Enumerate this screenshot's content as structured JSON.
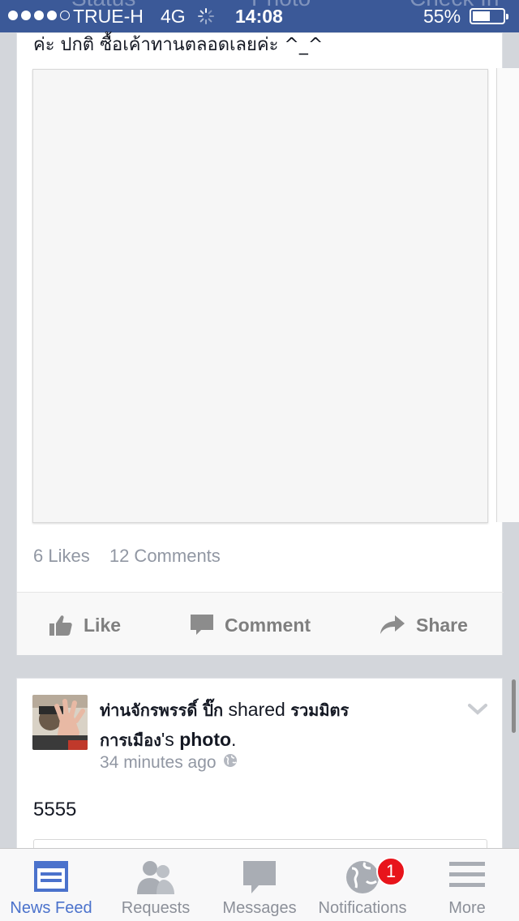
{
  "status_bar": {
    "carrier": "TRUE-H",
    "network": "4G",
    "time": "14:08",
    "battery": "55%",
    "battery_level": 0.55,
    "signal_bars": 4,
    "signal_max": 5
  },
  "composer_behind": {
    "status": "Status",
    "photo": "Photo",
    "check_in": "Check In"
  },
  "post1": {
    "text_tail": "ค่ะ ปกติ ซื้อเค้าทานตลอดเลยค่ะ ^_^",
    "likes": "6 Likes",
    "comments": "12 Comments",
    "like_label": "Like",
    "comment_label": "Comment",
    "share_label": "Share"
  },
  "post2": {
    "author": "ท่านจักรพรรดิ์ ปิ๊ก",
    "shared": "shared",
    "page_name": "รวมมิตรการเมือง",
    "possessive": "'s",
    "photo_word": "photo",
    "period": ".",
    "time": "34 minutes ago",
    "body": "5555"
  },
  "tabbar": {
    "tabs": [
      {
        "label": "News Feed",
        "icon": "news-feed-icon",
        "active": true
      },
      {
        "label": "Requests",
        "icon": "friend-requests-icon",
        "active": false
      },
      {
        "label": "Messages",
        "icon": "messages-icon",
        "active": false
      },
      {
        "label": "Notifications",
        "icon": "globe-icon",
        "active": false,
        "badge": "1"
      },
      {
        "label": "More",
        "icon": "menu-icon",
        "active": false
      }
    ]
  },
  "colors": {
    "brand": "#3b5998",
    "active_tab": "#4b72cc",
    "badge": "#e8141b",
    "muted": "#9197a3"
  }
}
